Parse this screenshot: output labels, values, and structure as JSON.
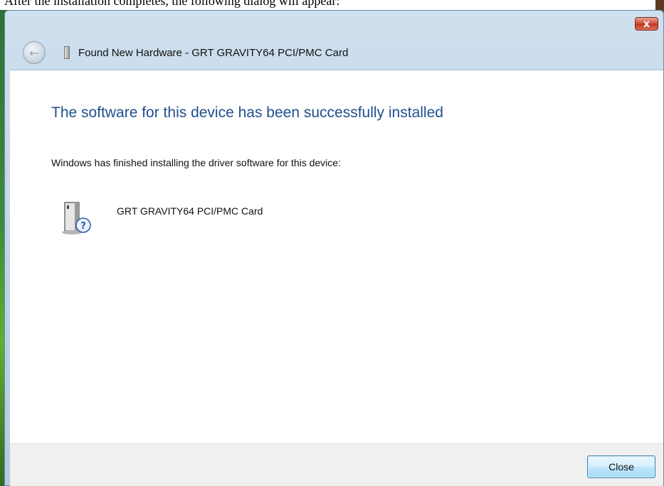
{
  "document_caption": "After the installation completes, the following dialog will appear:",
  "window": {
    "title": "Found New Hardware - GRT GRAVITY64 PCI/PMC Card",
    "close_glyph": "x"
  },
  "content": {
    "heading": "The software for this device has been successfully installed",
    "subtext": "Windows has finished installing the driver software for this device:",
    "device_name": "GRT GRAVITY64 PCI/PMC Card",
    "device_icon": "hardware-question-icon"
  },
  "footer": {
    "close_label": "Close"
  },
  "colors": {
    "heading": "#1f4f8e",
    "titlebar": "#bcd3e6",
    "close_button_red": "#c1391f",
    "footer": "#f0f0f0"
  }
}
